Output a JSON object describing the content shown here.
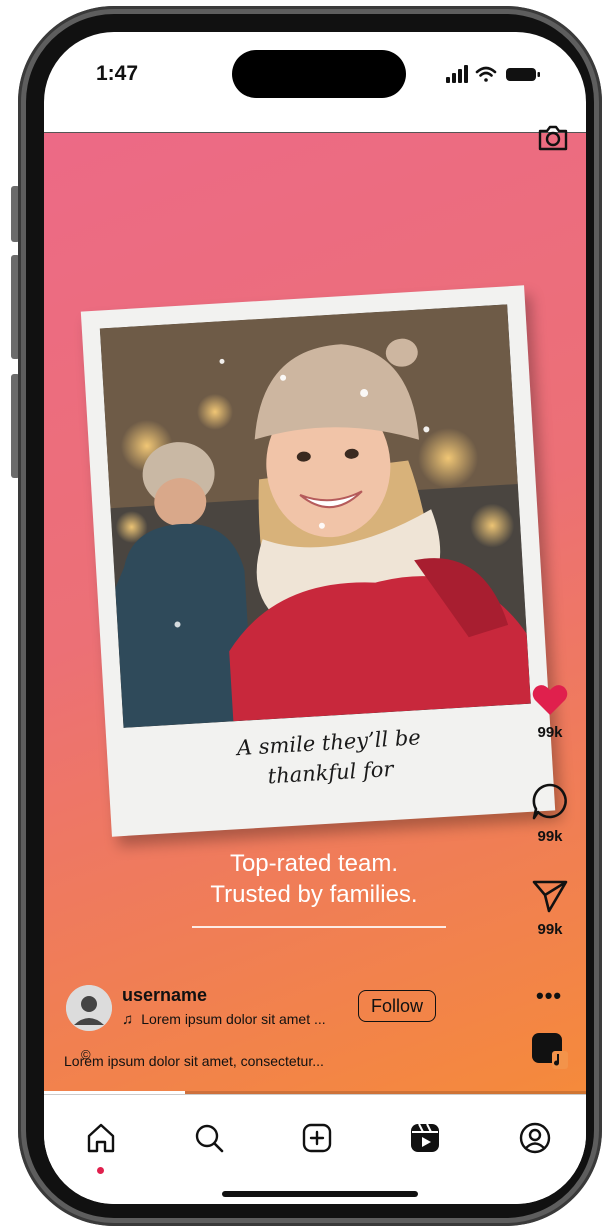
{
  "status_bar": {
    "time": "1:47"
  },
  "post": {
    "caption": "A smile they’ll be thankful for",
    "tagline_line1": "Top-rated team.",
    "tagline_line2": "Trusted by families.",
    "progress": 0.26
  },
  "actions": {
    "likes": "99k",
    "comments": "99k",
    "shares": "99k",
    "more_label": "•••"
  },
  "author": {
    "username": "username",
    "song": "Lorem ipsum dolor sit amet ...",
    "follow_label": "Follow"
  },
  "description": "Lorem ipsum dolor sit amet, consectetur...",
  "colors": {
    "gradient_top": "#ec6a86",
    "gradient_bottom": "#f58a3b",
    "like": "#e0204d",
    "text": "#111111",
    "white": "#ffffff"
  },
  "icons": [
    "camera-icon",
    "heart-icon",
    "comment-icon",
    "send-icon",
    "more-icon",
    "music-icon",
    "home-icon",
    "search-icon",
    "create-icon",
    "reels-icon",
    "profile-icon"
  ]
}
